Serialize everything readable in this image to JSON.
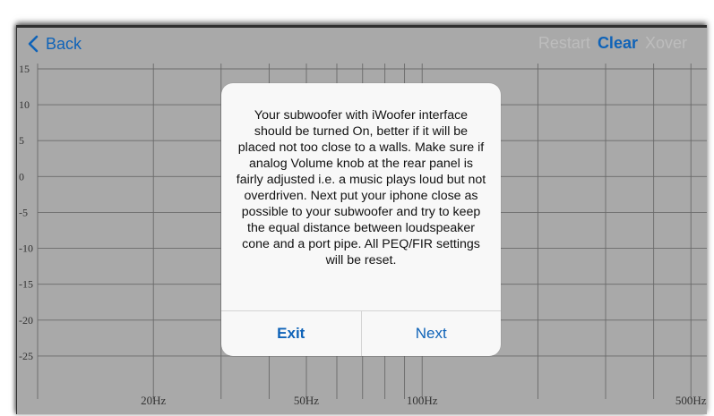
{
  "navbar": {
    "back_label": "Back",
    "actions": [
      "Restart",
      "Clear",
      "Xover"
    ],
    "active_action": "Clear"
  },
  "chart_data": {
    "type": "line",
    "y_ticks": [
      "15",
      "10",
      "5",
      "0",
      "-5",
      "-10",
      "-15",
      "-20",
      "-25"
    ],
    "x_ticks": [
      "20Hz",
      "50Hz",
      "100Hz",
      "500Hz"
    ],
    "y_range": [
      -30,
      15
    ],
    "x_range_hz": [
      10,
      550
    ],
    "x_scale": "log",
    "grid": true
  },
  "dialog": {
    "message": "Your subwoofer with iWoofer interface should be turned On, better if it will be placed not too close to a walls. Make sure if analog Volume knob at the rear panel is fairly adjusted i.e. a music plays loud but not overdriven. Next put your iphone close as possible to your subwoofer and try to keep the equal distance between loudspeaker cone and a port pipe. All PEQ/FIR settings will be reset.",
    "exit_label": "Exit",
    "next_label": "Next"
  },
  "colors": {
    "accent": "#0f63b8",
    "background": "#a9a9a9",
    "dim_text": "#bdbdbd"
  }
}
